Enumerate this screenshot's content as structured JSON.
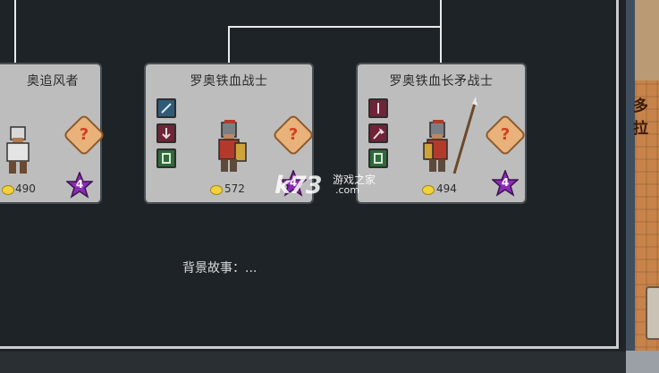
{
  "cards": [
    {
      "title": "奥追风者",
      "gold": "490",
      "level": "4"
    },
    {
      "title": "罗奥铁血战士",
      "gold": "572",
      "level": "4"
    },
    {
      "title": "罗奥铁血长矛战士",
      "gold": "494",
      "level": "4"
    }
  ],
  "help_glyph": "?",
  "backstory_label": "背景故事：...",
  "watermark": {
    "logo": "k73",
    "line1": "游戏之家",
    "line2": ".com"
  },
  "side_text": "多拉",
  "colors": {
    "card_bg": "#bdbdbd",
    "panel_bg": "#1e2327",
    "star": "#8b2bb5",
    "badge": "#e8b27a"
  }
}
